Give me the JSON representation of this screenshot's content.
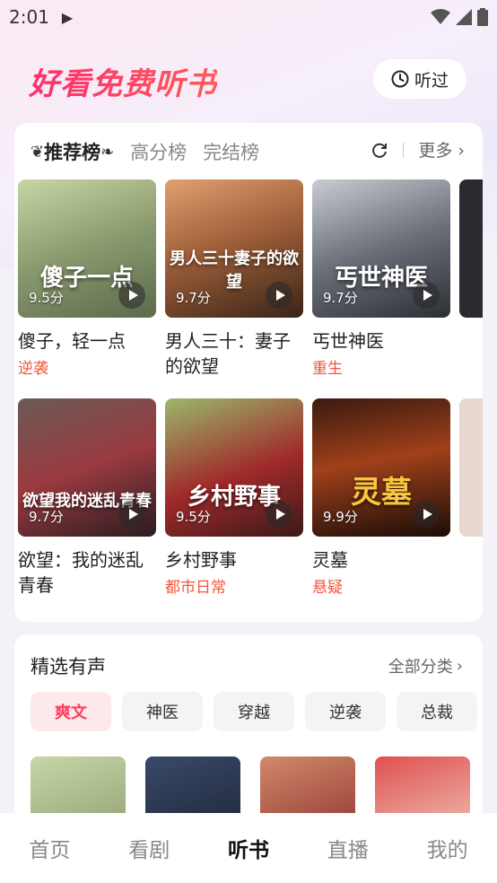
{
  "status_bar": {
    "time": "2:01"
  },
  "header": {
    "title": "好看免费听书",
    "history_label": "听过"
  },
  "ranking": {
    "tabs": [
      "推荐榜",
      "高分榜",
      "完结榜"
    ],
    "more_label": "更多",
    "books": [
      {
        "title": "傻子，轻一点",
        "tag": "逆袭",
        "score": "9.5分",
        "cover_text": "傻子一点"
      },
      {
        "title": "男人三十：妻子的欲望",
        "tag": "",
        "score": "9.7分",
        "cover_text": "男人三十妻子的欲望"
      },
      {
        "title": "丐世神医",
        "tag": "重生",
        "score": "9.7分",
        "cover_text": "丐世神医"
      },
      {
        "title": "欲望：我的迷乱青春",
        "tag": "",
        "score": "9.7分",
        "cover_text": "欲望我的迷乱青春"
      },
      {
        "title": "乡村野事",
        "tag": "都市日常",
        "score": "9.5分",
        "cover_text": "乡村野事"
      },
      {
        "title": "灵墓",
        "tag": "悬疑",
        "score": "9.9分",
        "cover_text": "灵墓"
      }
    ]
  },
  "selection": {
    "title": "精选有声",
    "all_label": "全部分类",
    "chips": [
      "爽文",
      "神医",
      "穿越",
      "逆袭",
      "总裁"
    ]
  },
  "bottom_nav": {
    "items": [
      "首页",
      "看剧",
      "听书",
      "直播",
      "我的"
    ],
    "active": "听书"
  },
  "colors": {
    "accent": "#ff3b5c",
    "tag": "#f2553a"
  }
}
